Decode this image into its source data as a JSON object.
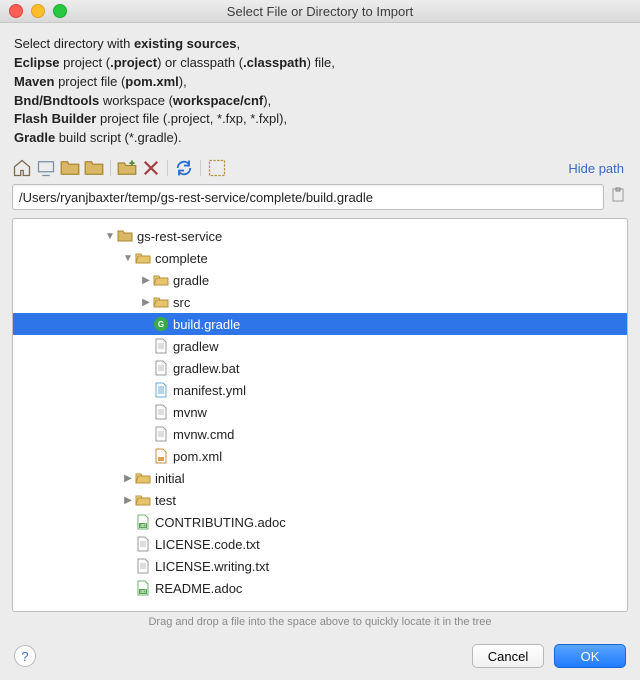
{
  "window": {
    "title": "Select File or Directory to Import"
  },
  "instruction": {
    "line1a": "Select directory with ",
    "line1b": "existing sources",
    "line1c": ",",
    "line2a": "Eclipse",
    "line2b": " project (",
    "line2c": ".project",
    "line2d": ") or classpath (",
    "line2e": ".classpath",
    "line2f": ") file,",
    "line3a": "Maven",
    "line3b": " project file (",
    "line3c": "pom.xml",
    "line3d": "),",
    "line4a": "Bnd/Bndtools",
    "line4b": " workspace (",
    "line4c": "workspace/cnf",
    "line4d": "),",
    "line5a": "Flash Builder",
    "line5b": " project file (.project, *.fxp, *.fxpl),",
    "line6a": "Gradle",
    "line6b": " build script (*.gradle)."
  },
  "toolbar": {
    "hide_path": "Hide path"
  },
  "path": {
    "value": "/Users/ryanjbaxter/temp/gs-rest-service/complete/build.gradle"
  },
  "tree": [
    {
      "indent": 5,
      "arrow": "down",
      "icon": "folder",
      "label": "gs-rest-service"
    },
    {
      "indent": 6,
      "arrow": "down",
      "icon": "folder-open",
      "label": "complete"
    },
    {
      "indent": 7,
      "arrow": "right",
      "icon": "folder-open",
      "label": "gradle"
    },
    {
      "indent": 7,
      "arrow": "right",
      "icon": "folder-open",
      "label": "src"
    },
    {
      "indent": 7,
      "arrow": "",
      "icon": "gradle",
      "label": "build.gradle",
      "selected": true
    },
    {
      "indent": 7,
      "arrow": "",
      "icon": "file",
      "label": "gradlew"
    },
    {
      "indent": 7,
      "arrow": "",
      "icon": "file",
      "label": "gradlew.bat"
    },
    {
      "indent": 7,
      "arrow": "",
      "icon": "yml",
      "label": "manifest.yml"
    },
    {
      "indent": 7,
      "arrow": "",
      "icon": "file",
      "label": "mvnw"
    },
    {
      "indent": 7,
      "arrow": "",
      "icon": "file",
      "label": "mvnw.cmd"
    },
    {
      "indent": 7,
      "arrow": "",
      "icon": "xml",
      "label": "pom.xml"
    },
    {
      "indent": 6,
      "arrow": "right",
      "icon": "folder-open",
      "label": "initial"
    },
    {
      "indent": 6,
      "arrow": "right",
      "icon": "folder-open",
      "label": "test"
    },
    {
      "indent": 6,
      "arrow": "",
      "icon": "adoc",
      "label": "CONTRIBUTING.adoc"
    },
    {
      "indent": 6,
      "arrow": "",
      "icon": "file",
      "label": "LICENSE.code.txt"
    },
    {
      "indent": 6,
      "arrow": "",
      "icon": "file",
      "label": "LICENSE.writing.txt"
    },
    {
      "indent": 6,
      "arrow": "",
      "icon": "adoc",
      "label": "README.adoc"
    }
  ],
  "hint": "Drag and drop a file into the space above to quickly locate it in the tree",
  "buttons": {
    "cancel": "Cancel",
    "ok": "OK"
  }
}
